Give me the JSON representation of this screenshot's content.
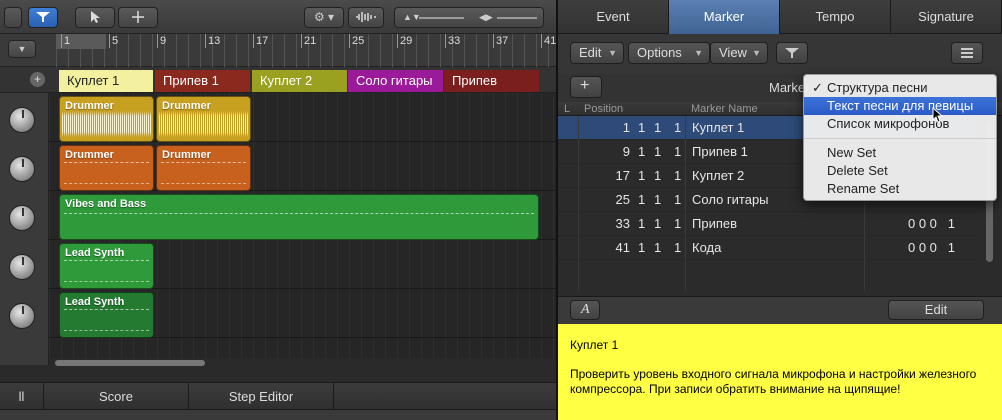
{
  "toolbar": {
    "quantize_icon": "filter-icon",
    "pointer_icon": "arrow-icon",
    "crosshair_icon": "crosshair-icon",
    "gear_icon": "gear-icon",
    "waveform_icon": "waveform-icon"
  },
  "ruler": {
    "bars": [
      "1",
      "5",
      "9",
      "13",
      "17",
      "21",
      "25",
      "29",
      "33",
      "37",
      "41"
    ]
  },
  "marker_lane": [
    {
      "label": "Куплет 1",
      "color": "#f3f0a0",
      "text_color": "#222"
    },
    {
      "label": "Припев 1",
      "color": "#8a2a1e",
      "text_color": "#fff"
    },
    {
      "label": "Куплет 2",
      "color": "#9aa020",
      "text_color": "#fff"
    },
    {
      "label": "Соло гитары",
      "color": "#9a1a9a",
      "text_color": "#fff"
    },
    {
      "label": "Припев",
      "color": "#7a1e1e",
      "text_color": "#fff"
    }
  ],
  "regions": [
    {
      "name": "Drummer",
      "color": "#c8a020"
    },
    {
      "name": "Drummer",
      "color": "#c8a020"
    },
    {
      "name": "Drummer",
      "color": "#c8601e"
    },
    {
      "name": "Drummer",
      "color": "#c8601e"
    },
    {
      "name": "Vibes and Bass",
      "color": "#2e9a3a"
    },
    {
      "name": "Lead Synth",
      "color": "#2e9a3a"
    },
    {
      "name": "Lead Synth",
      "color": "#237a30"
    }
  ],
  "bottom_tabs": [
    "ll",
    "Score",
    "Step Editor"
  ],
  "right_tabs": {
    "items": [
      "Event",
      "Marker",
      "Tempo",
      "Signature"
    ],
    "active": "Marker"
  },
  "marker_toolbar": {
    "edit": "Edit",
    "options": "Options",
    "view": "View",
    "filter_icon": "filter-icon",
    "list_icon": "list-icon"
  },
  "marker_header_left": "Marker",
  "add_icon": "plus-icon",
  "table": {
    "headers": {
      "l": "L",
      "position": "Position",
      "name": "Marker Name"
    },
    "rows": [
      {
        "bar": "1",
        "beat": "1",
        "div": "1",
        "tick": "1",
        "name": "Куплет 1",
        "extra": ""
      },
      {
        "bar": "9",
        "beat": "1",
        "div": "1",
        "tick": "1",
        "name": "Припев 1",
        "extra": ""
      },
      {
        "bar": "17",
        "beat": "1",
        "div": "1",
        "tick": "1",
        "name": "Куплет 2",
        "extra": ""
      },
      {
        "bar": "25",
        "beat": "1",
        "div": "1",
        "tick": "1",
        "name": "Соло гитары",
        "extra": ""
      },
      {
        "bar": "33",
        "beat": "1",
        "div": "1",
        "tick": "1",
        "name": "Припев",
        "extra": "0 0 0   1"
      },
      {
        "bar": "41",
        "beat": "1",
        "div": "1",
        "tick": "1",
        "name": "Кода",
        "extra": "0 0 0   1"
      }
    ]
  },
  "notes_bar": {
    "text_icon": "A",
    "edit": "Edit"
  },
  "notes": {
    "title": "Куплет 1",
    "body": "Проверить уровень входного сигнала микрофона и настройки железного компрессора. При записи обратить внимание на щипящие!"
  },
  "menu": {
    "items": [
      {
        "label": "Структура песни",
        "checked": true
      },
      {
        "label": "Текст песни для певицы",
        "highlighted": true
      },
      {
        "label": "Список микрофонов"
      },
      {
        "label": "New Set"
      },
      {
        "label": "Delete Set"
      },
      {
        "label": "Rename Set"
      }
    ],
    "checkmark": "✓"
  }
}
